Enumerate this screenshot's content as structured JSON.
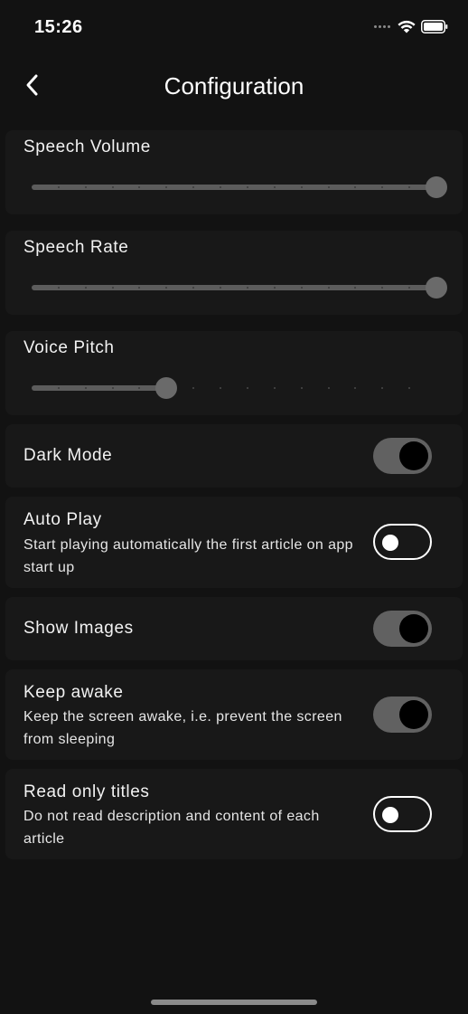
{
  "status_bar": {
    "time": "15:26",
    "icons": [
      "signal-dots-icon",
      "wifi-icon",
      "battery-icon"
    ]
  },
  "header": {
    "back_icon": "chevron-left-icon",
    "title": "Configuration"
  },
  "sliders": [
    {
      "label": "Speech Volume",
      "value_fraction": 1.0
    },
    {
      "label": "Speech Rate",
      "value_fraction": 1.0
    },
    {
      "label": "Voice Pitch",
      "value_fraction": 0.333
    }
  ],
  "toggles": [
    {
      "label": "Dark Mode",
      "description": "",
      "on": true
    },
    {
      "label": "Auto Play",
      "description": "Start playing automatically the first article on app start up",
      "on": false
    },
    {
      "label": "Show Images",
      "description": "",
      "on": true
    },
    {
      "label": "Keep awake",
      "description": "Keep the screen awake, i.e. prevent the screen from sleeping",
      "on": true
    },
    {
      "label": "Read only titles",
      "description": "Do not read description and content of each article",
      "on": false
    }
  ],
  "colors": {
    "background": "#121212",
    "card": "#181818",
    "toggle_on_track": "#616161",
    "slider_active": "#5c5c5c",
    "text": "#ffffff"
  }
}
